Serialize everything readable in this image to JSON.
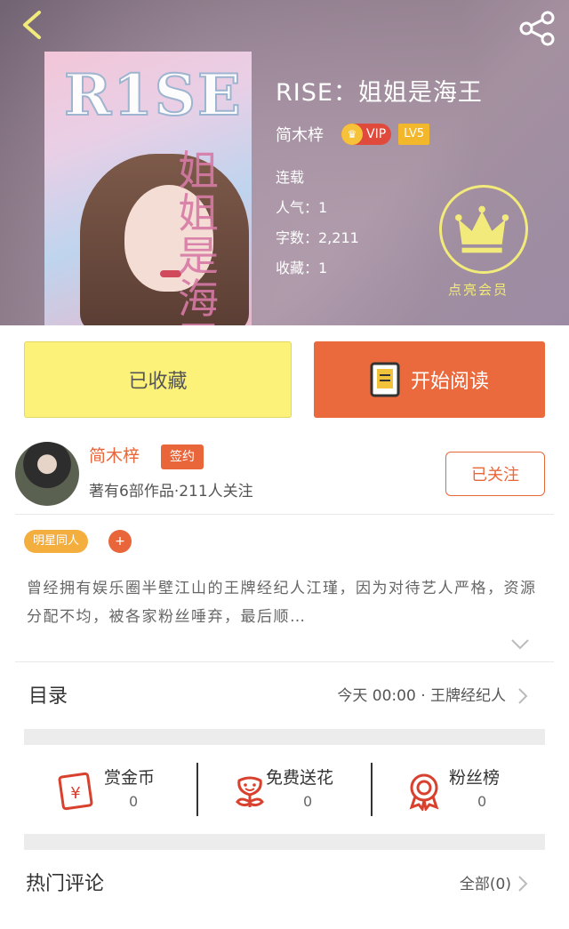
{
  "book": {
    "title": "RISE：姐姐是海王",
    "cover_title": "R1SE",
    "cover_subtitle": "姐姐是海王",
    "author": "简木梓",
    "vip_label": "VIP",
    "level_label": "LV5",
    "status": "连载",
    "popularity": "人气：1",
    "word_count": "字数：2,211",
    "favorites": "收藏：1",
    "vip_cta": "点亮会员"
  },
  "actions": {
    "collect_label": "已收藏",
    "read_label": "开始阅读"
  },
  "author_card": {
    "name": "简木梓",
    "sign_badge": "签约",
    "works_info": "著有6部作品·211人关注",
    "follow_label": "已关注"
  },
  "tags": {
    "chip": "明星同人",
    "add": "+"
  },
  "summary": "曾经拥有娱乐圈半壁江山的王牌经纪人江瑾，因为对待艺人严格，资源分配不均，被各家粉丝唾弃，最后顺…",
  "toc": {
    "label": "目录",
    "latest": "今天 00:00 · 王牌经纪人"
  },
  "stats": [
    {
      "label": "赏金币",
      "value": "0",
      "icon": "coin-envelope-icon"
    },
    {
      "label": "免费送花",
      "value": "0",
      "icon": "flower-icon"
    },
    {
      "label": "粉丝榜",
      "value": "0",
      "icon": "rank-medal-icon"
    }
  ],
  "comments": {
    "label": "热门评论",
    "all": "全部(0)"
  },
  "colors": {
    "accent": "#e8663a",
    "collect_bg": "#fcf179",
    "vip_yellow": "#f2ea7a"
  }
}
